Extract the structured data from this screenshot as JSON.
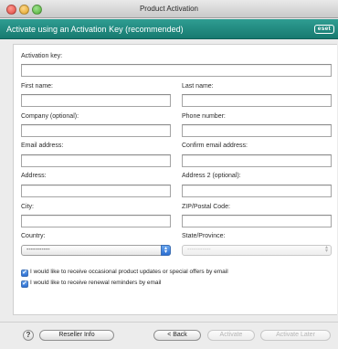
{
  "window": {
    "title": "Product Activation"
  },
  "header": {
    "title": "Activate using an Activation Key (recommended)",
    "brand": "eset"
  },
  "form": {
    "activation_key": {
      "label": "Activation key:",
      "value": ""
    },
    "first_name": {
      "label": "First name:",
      "value": ""
    },
    "last_name": {
      "label": "Last name:",
      "value": ""
    },
    "company": {
      "label": "Company (optional):",
      "value": ""
    },
    "phone": {
      "label": "Phone number:",
      "value": ""
    },
    "email": {
      "label": "Email address:",
      "value": ""
    },
    "confirm_email": {
      "label": "Confirm email address:",
      "value": ""
    },
    "address": {
      "label": "Address:",
      "value": ""
    },
    "address2": {
      "label": "Address 2 (optional):",
      "value": ""
    },
    "city": {
      "label": "City:",
      "value": ""
    },
    "zip": {
      "label": "ZIP/Postal Code:",
      "value": ""
    },
    "country": {
      "label": "Country:",
      "selected": "-----------"
    },
    "state": {
      "label": "State/Province:",
      "selected": "-----------",
      "disabled": true
    }
  },
  "checkboxes": [
    {
      "label": "I would like to receive occasional product updates or special offers by email",
      "checked": true
    },
    {
      "label": "I would like to receive renewal reminders by email",
      "checked": true
    }
  ],
  "footer": {
    "help": "?",
    "reseller": "Reseller Info",
    "back": "< Back",
    "activate": "Activate",
    "activate_later": "Activate Later"
  },
  "colors": {
    "header_bg": "#1f8a7f",
    "checkbox_accent": "#2a6dd2"
  }
}
